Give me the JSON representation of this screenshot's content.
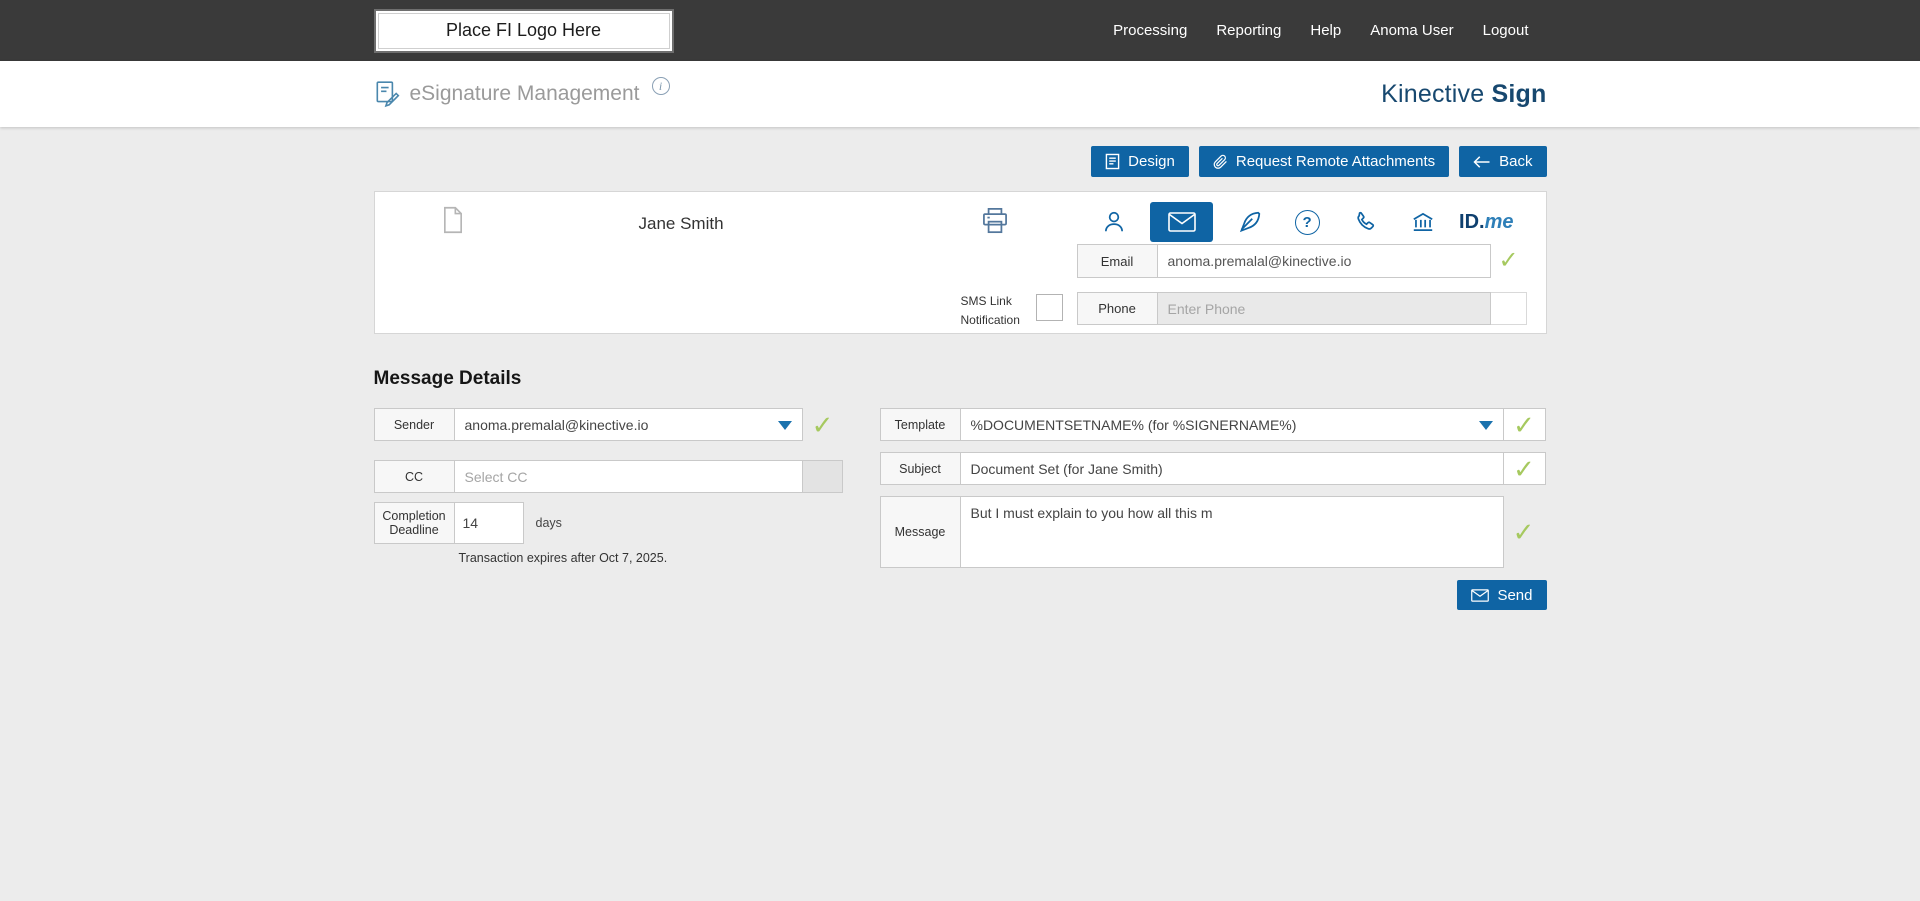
{
  "topbar": {
    "logo_label": "Place FI Logo Here",
    "nav": [
      {
        "label": "Processing"
      },
      {
        "label": "Reporting"
      },
      {
        "label": "Help"
      },
      {
        "label": "Anoma User"
      },
      {
        "label": "Logout"
      }
    ]
  },
  "header": {
    "title": "eSignature Management",
    "info_icon": "info-icon",
    "brand_primary": "Kinective",
    "brand_bold": "Sign"
  },
  "toolbar": {
    "design_label": "Design",
    "attachments_label": "Request Remote Attachments",
    "back_label": "Back"
  },
  "recipient": {
    "name": "Jane Smith",
    "delivery_methods": [
      {
        "icon": "person-icon",
        "selected": false
      },
      {
        "icon": "envelope-icon",
        "selected": true
      },
      {
        "icon": "quill-pen-icon",
        "selected": false
      },
      {
        "icon": "question-circle-icon",
        "selected": false
      },
      {
        "icon": "phone-icon",
        "selected": false
      },
      {
        "icon": "bank-icon",
        "selected": false
      },
      {
        "icon": "idme-logo",
        "selected": false
      }
    ],
    "idme_text_bold": "ID.",
    "idme_text_italic": "me",
    "email_label": "Email",
    "email_value": "anoma.premalal@kinective.io",
    "sms_label": "SMS Link Notification",
    "sms_checked": false,
    "phone_label": "Phone",
    "phone_placeholder": "Enter Phone"
  },
  "message_details": {
    "heading": "Message Details",
    "sender_label": "Sender",
    "sender_value": "anoma.premalal@kinective.io",
    "cc_label": "CC",
    "cc_placeholder": "Select CC",
    "deadline_label": "Completion Deadline",
    "deadline_value": "14",
    "deadline_unit": "days",
    "expires_note": "Transaction expires after Oct 7, 2025.",
    "template_label": "Template",
    "template_value": "%DOCUMENTSETNAME% (for %SIGNERNAME%)",
    "subject_label": "Subject",
    "subject_value": "Document Set (for Jane Smith)",
    "message_label": "Message",
    "message_value": "But I must explain to you how all this m",
    "send_label": "Send"
  },
  "colors": {
    "accent_blue": "#0f64a4",
    "brand_navy": "#17486f",
    "check_green": "#a6c95f",
    "topbar_bg": "#3a3a3a",
    "page_bg": "#ececec"
  }
}
